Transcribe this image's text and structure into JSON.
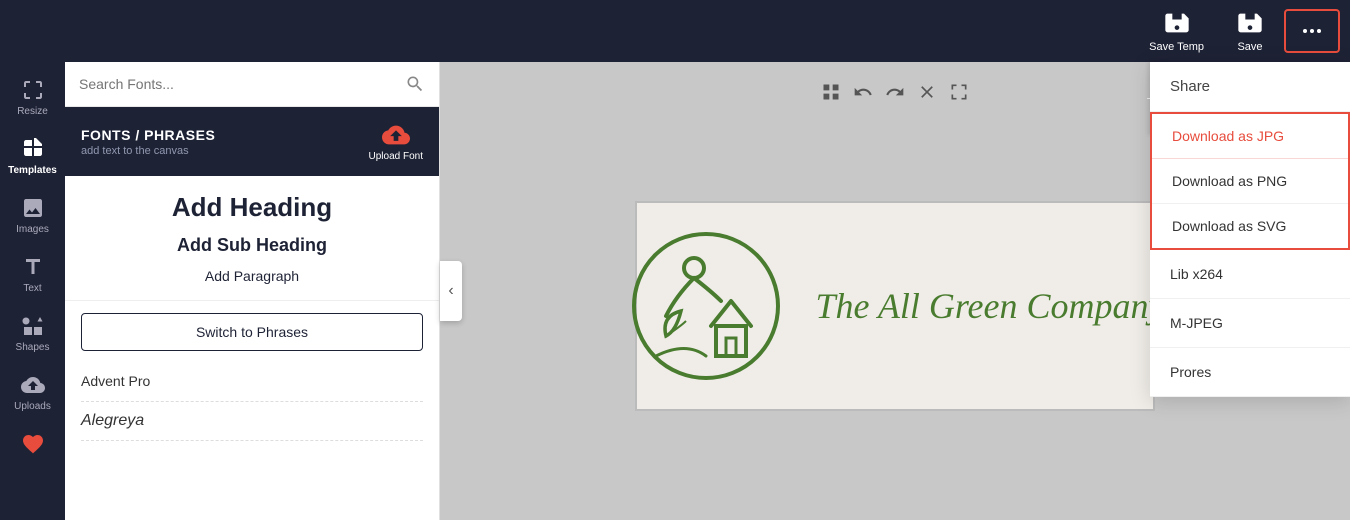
{
  "toolbar": {
    "save_temp_label": "Save Temp",
    "save_label": "Save",
    "more_label": "..."
  },
  "sidebar": {
    "items": [
      {
        "id": "resize",
        "label": "Resize",
        "icon": "resize"
      },
      {
        "id": "templates",
        "label": "Templates",
        "icon": "templates"
      },
      {
        "id": "images",
        "label": "Images",
        "icon": "images"
      },
      {
        "id": "text",
        "label": "Text",
        "icon": "text"
      },
      {
        "id": "shapes",
        "label": "Shapes",
        "icon": "shapes"
      },
      {
        "id": "uploads",
        "label": "Uploads",
        "icon": "uploads"
      },
      {
        "id": "favorites",
        "label": "Favorites",
        "icon": "heart"
      }
    ]
  },
  "left_panel": {
    "search_placeholder": "Search Fonts...",
    "section_title": "FONTS / PHRASES",
    "section_subtitle": "add text to the canvas",
    "upload_font_label": "Upload Font",
    "add_heading": "Add Heading",
    "add_subheading": "Add Sub Heading",
    "add_paragraph": "Add Paragraph",
    "switch_btn": "Switch to Phrases",
    "fonts": [
      {
        "name": "Advent Pro"
      },
      {
        "name": "Alegreya"
      }
    ]
  },
  "canvas": {
    "logo_text": "The All Green Company"
  },
  "dropdown": {
    "items": [
      {
        "id": "share",
        "label": "Share",
        "highlighted": false
      },
      {
        "id": "download-jpg",
        "label": "Download as JPG",
        "highlighted": true
      },
      {
        "id": "download-png",
        "label": "Download as PNG",
        "highlighted": true
      },
      {
        "id": "download-svg",
        "label": "Download as SVG",
        "highlighted": true
      },
      {
        "id": "lib-x264",
        "label": "Lib x264",
        "highlighted": false
      },
      {
        "id": "m-jpeg",
        "label": "M-JPEG",
        "highlighted": false
      },
      {
        "id": "prores",
        "label": "Prores",
        "highlighted": false
      }
    ]
  },
  "colors": {
    "dark_bg": "#1e2235",
    "accent_red": "#e74c3c",
    "green": "#4a7c2f",
    "white": "#ffffff"
  }
}
